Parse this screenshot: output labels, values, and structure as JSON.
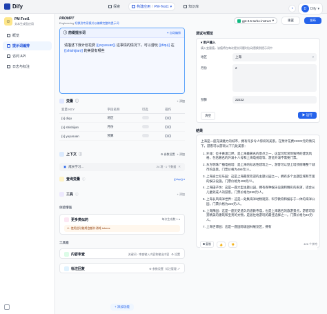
{
  "topbar": {
    "brand": "Dify",
    "nav": [
      {
        "label": "探索"
      },
      {
        "label": "构建应用"
      },
      {
        "label": "PM-Test1"
      },
      {
        "label": "知识库"
      }
    ],
    "avatar_initial": "D",
    "username": "Dify"
  },
  "sidebar": {
    "app_name": "PM-Test1",
    "app_type": "文本生成型应用",
    "items": [
      {
        "label": "概览"
      },
      {
        "label": "提示词编排"
      },
      {
        "label": "访问 API"
      },
      {
        "label": "日志与标注"
      }
    ]
  },
  "prompt": {
    "title": "PROMPT",
    "subtitle_prefix": "Engineering",
    "subtitle_link": "切换到专家模式以编辑完整的提示词",
    "prefix_label": "前缀提示词",
    "auto_label": "自动编排",
    "body_parts": [
      {
        "text": "请描述下我计划花费 ",
        "var": false
      },
      {
        "text": "{{yuyusuan}}",
        "var": true
      },
      {
        "text": " 这事情的情况下，可以游玩 ",
        "var": false
      },
      {
        "text": "{{diqu}}",
        "var": true
      },
      {
        "text": " 在 ",
        "var": false
      },
      {
        "text": "{{shishijian}}",
        "var": true
      },
      {
        "text": " 的美景有哪些",
        "var": false
      }
    ]
  },
  "variables": {
    "title": "变量",
    "add_label": "+ 添加",
    "columns": [
      "变量 KEY",
      "字段名称",
      "可选",
      "操作"
    ],
    "rows": [
      {
        "key": "diqu",
        "name": "地区"
      },
      {
        "key": "shishijian",
        "name": "月份"
      },
      {
        "key": "yuyusuan",
        "name": "预算"
      }
    ]
  },
  "context": {
    "title": "上下文",
    "param_setting": "参数设置",
    "add_label": "+ 添加",
    "dataset_name": "成长学习...",
    "dataset_meta": "24 项 · 1 个数据"
  },
  "query_var": {
    "title": "查询变量",
    "value": "{{diqu}}"
  },
  "tools": {
    "title": "工具",
    "add_label": "+ 添加"
  },
  "experience": {
    "group": "体验增强",
    "more_like_this": "更多类似的",
    "more_like_this_setting": "每次生成数 1",
    "warning": "使用此功能将会额外消耗 tokens"
  },
  "toolbox": {
    "group": "工具箱",
    "moderation": "内容审查",
    "moderation_meta": "关键词 · 审查输入内容和输出内容",
    "moderation_setting": "设置",
    "annotation": "标注回复",
    "annotation_setting": "参数设置",
    "annotation_manage": "标注管理"
  },
  "add_feature": "+ 添加功能",
  "header_actions": {
    "model": "gpt-3.5-turbo-instruct",
    "restore": "重置",
    "publish": "发布"
  },
  "debug": {
    "title": "调试与预览",
    "user_input_title": "用户输入",
    "user_input_sub": "填入变量值，该值将在每次提交问题时自动替换到提示词中",
    "fields": [
      {
        "label": "地区",
        "value": "上海"
      },
      {
        "label": "月份",
        "value": "2"
      },
      {
        "label": "预算",
        "value": "22222"
      }
    ],
    "clear": "清空",
    "run": "运行"
  },
  "result": {
    "label": "结果",
    "intro": "上海是一座充满魅力的城市，拥有许多令人惊叹的美景。在预计花费22222元的情况下，游客可以游玩以下几处美景：",
    "items": [
      "外滩：位于黄浦江畔，是上海最著名的景点之一，这里可欣赏到独特的建筑风格，包括著名的外滩十八号和上海电视塔等，游览外滩不需要门票。",
      "东方明珠广播电视塔：是上海的标志性建筑之一，游客可以登上塔顶俯瞰整个城市的美景。门票价格为499元/人。",
      "上海迪士尼乐园：这是上海最受欢迎的主题公园之一，拥有多个主题区域和丰富的娱乐设施。门票价格为499元/人。",
      "上海田子坊：这是一座大型主题公园，拥有各种娱乐设施和精彩的表演，适合从儿童到成人的游客。门票价格为499元/人。",
      "上海长风海洋世界：这是一处集海洋动物观赏、科学教育和娱乐于一体的海洋公园，门票价格为220元/人。",
      "上海豫园：这是一座历史悠久的道教寺庙，也是上海著名的旅游景点，游客可欣赏精美的建筑和宝贵的文物，是居住地游玩的最佳选择之一。门票价格为40元/人。",
      "上海世博园：这是一座国际级园林展览区，拥有"
    ],
    "copy": "复制",
    "char_count": "426 个字符"
  }
}
